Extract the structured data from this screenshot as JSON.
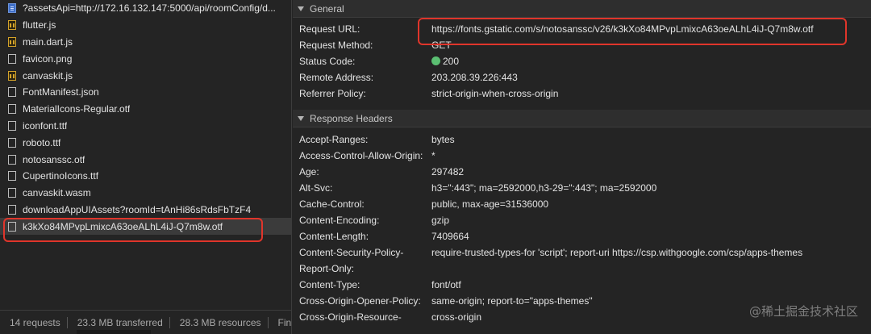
{
  "files": [
    {
      "name": "?assetsApi=http://172.16.132.147:5000/api/roomConfig/d...",
      "icon": "doc-icon",
      "type": "doc"
    },
    {
      "name": "flutter.js",
      "icon": "js-file-icon",
      "type": "js"
    },
    {
      "name": "main.dart.js",
      "icon": "js-file-icon",
      "type": "js"
    },
    {
      "name": "favicon.png",
      "icon": "file-icon",
      "type": "file"
    },
    {
      "name": "canvaskit.js",
      "icon": "js-file-icon",
      "type": "js"
    },
    {
      "name": "FontManifest.json",
      "icon": "file-icon",
      "type": "file"
    },
    {
      "name": "MaterialIcons-Regular.otf",
      "icon": "file-icon",
      "type": "file"
    },
    {
      "name": "iconfont.ttf",
      "icon": "file-icon",
      "type": "file"
    },
    {
      "name": "roboto.ttf",
      "icon": "file-icon",
      "type": "file"
    },
    {
      "name": "notosanssc.otf",
      "icon": "file-icon",
      "type": "file"
    },
    {
      "name": "CupertinoIcons.ttf",
      "icon": "file-icon",
      "type": "file"
    },
    {
      "name": "canvaskit.wasm",
      "icon": "file-icon",
      "type": "file"
    },
    {
      "name": "downloadAppUIAssets?roomId=tAnHi86sRdsFbTzF4",
      "icon": "file-icon",
      "type": "file"
    },
    {
      "name": "k3kXo84MPvpLmixcA63oeALhL4iJ-Q7m8w.otf",
      "icon": "file-icon",
      "type": "file",
      "selected": true
    }
  ],
  "status_bar": {
    "requests": "14 requests",
    "transferred": "23.3 MB transferred",
    "resources": "28.3 MB resources",
    "finish": "Fini"
  },
  "general": {
    "title": "General",
    "request_url_label": "Request URL:",
    "request_url": "https://fonts.gstatic.com/s/notosanssc/v26/k3kXo84MPvpLmixcA63oeALhL4iJ-Q7m8w.otf",
    "request_method_label": "Request Method:",
    "request_method": "GET",
    "status_code_label": "Status Code:",
    "status_code": "200",
    "remote_address_label": "Remote Address:",
    "remote_address": "203.208.39.226:443",
    "referrer_policy_label": "Referrer Policy:",
    "referrer_policy": "strict-origin-when-cross-origin"
  },
  "response_headers": {
    "title": "Response Headers",
    "items": [
      {
        "k": "Accept-Ranges:",
        "v": "bytes"
      },
      {
        "k": "Access-Control-Allow-Origin:",
        "v": "*"
      },
      {
        "k": "Age:",
        "v": "297482"
      },
      {
        "k": "Alt-Svc:",
        "v": "h3=\":443\"; ma=2592000,h3-29=\":443\"; ma=2592000"
      },
      {
        "k": "Cache-Control:",
        "v": "public, max-age=31536000"
      },
      {
        "k": "Content-Encoding:",
        "v": "gzip"
      },
      {
        "k": "Content-Length:",
        "v": "7409664"
      },
      {
        "k": "Content-Security-Policy-",
        "v": "require-trusted-types-for 'script'; report-uri https://csp.withgoogle.com/csp/apps-themes"
      },
      {
        "k": "Report-Only:",
        "v": ""
      },
      {
        "k": "Content-Type:",
        "v": "font/otf"
      },
      {
        "k": "Cross-Origin-Opener-Policy:",
        "v": "same-origin; report-to=\"apps-themes\""
      },
      {
        "k": "Cross-Origin-Resource-",
        "v": "cross-origin"
      }
    ]
  },
  "watermark": "@稀土掘金技术社区",
  "colors": {
    "highlight": "#e0352b",
    "status_ok": "#5bbf72"
  }
}
